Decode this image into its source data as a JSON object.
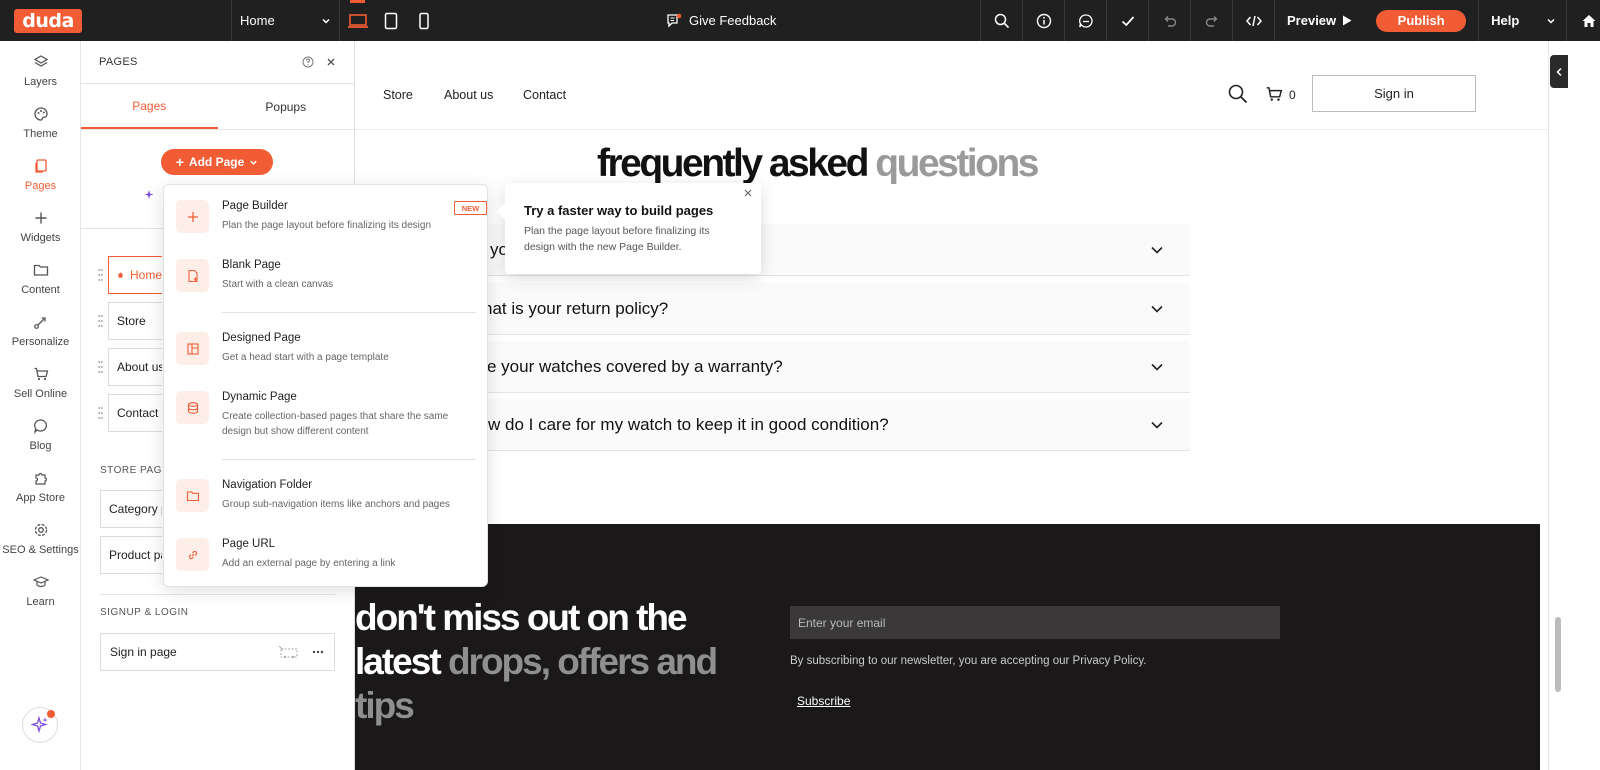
{
  "topbar": {
    "logo": "duda",
    "page_select": "Home",
    "feedback": "Give Feedback",
    "preview": "Preview",
    "publish": "Publish",
    "help": "Help"
  },
  "leftnav": {
    "items": [
      {
        "label": "Layers",
        "icon": "layers-icon"
      },
      {
        "label": "Theme",
        "icon": "palette-icon"
      },
      {
        "label": "Pages",
        "icon": "pages-icon"
      },
      {
        "label": "Widgets",
        "icon": "plus-icon"
      },
      {
        "label": "Content",
        "icon": "folder-icon"
      },
      {
        "label": "Personalize",
        "icon": "personalize-icon"
      },
      {
        "label": "Sell Online",
        "icon": "cart-icon"
      },
      {
        "label": "Blog",
        "icon": "chat-bubble-icon"
      },
      {
        "label": "App Store",
        "icon": "puzzle-icon"
      },
      {
        "label": "SEO & Settings",
        "icon": "gear-icon"
      },
      {
        "label": "Learn",
        "icon": "graduation-cap-icon"
      }
    ],
    "active": "Pages"
  },
  "panel": {
    "title": "PAGES",
    "tabs": [
      "Pages",
      "Popups"
    ],
    "add_page": "Add Page",
    "pages": [
      "Home",
      "Store",
      "About us",
      "Contact"
    ],
    "store_section": "STORE PAGES",
    "store_pages": [
      "Category page",
      "Product page"
    ],
    "signup_section": "SIGNUP & LOGIN",
    "signin_page": "Sign in page"
  },
  "dropdown": {
    "items": [
      {
        "title": "Page Builder",
        "desc": "Plan the page layout before finalizing its design",
        "badge": "NEW",
        "icon": "plus-icon"
      },
      {
        "title": "Blank Page",
        "desc": "Start with a clean canvas",
        "icon": "blank-page-icon"
      },
      {
        "title": "Designed Page",
        "desc": "Get a head start with a page template",
        "icon": "layout-icon"
      },
      {
        "title": "Dynamic Page",
        "desc": "Create collection-based pages that share the same design but show different content",
        "icon": "database-icon"
      },
      {
        "title": "Navigation Folder",
        "desc": "Group sub-navigation items like anchors and pages",
        "icon": "folder-icon"
      },
      {
        "title": "Page URL",
        "desc": "Add an external page by entering a link",
        "icon": "link-icon"
      }
    ]
  },
  "tooltip": {
    "title": "Try a faster way to build pages",
    "desc": "Plan the page layout before finalizing its design with the new Page Builder."
  },
  "site": {
    "nav": [
      "Store",
      "About us",
      "Contact"
    ],
    "cart_count": "0",
    "signin": "Sign in",
    "faq_title_dark": "frequently asked",
    "faq_title_gray": "questions",
    "faq_partial_first": "yo",
    "faqs": [
      "hat is your return policy?",
      "e your watches covered by a warranty?",
      "w do I care for my watch to keep it in good condition?"
    ],
    "footer_title_line1": "don't miss out on the",
    "footer_title_line2_dark": "latest",
    "footer_title_line2_gray": "drops, offers and",
    "footer_title_line3": "tips",
    "email_placeholder": "Enter your email",
    "newsletter_note": "By subscribing to our newsletter, you are accepting our Privacy Policy.",
    "subscribe": "Subscribe"
  },
  "colors": {
    "accent": "#f25c35",
    "topbar": "#202020",
    "footer": "#1a1818"
  }
}
